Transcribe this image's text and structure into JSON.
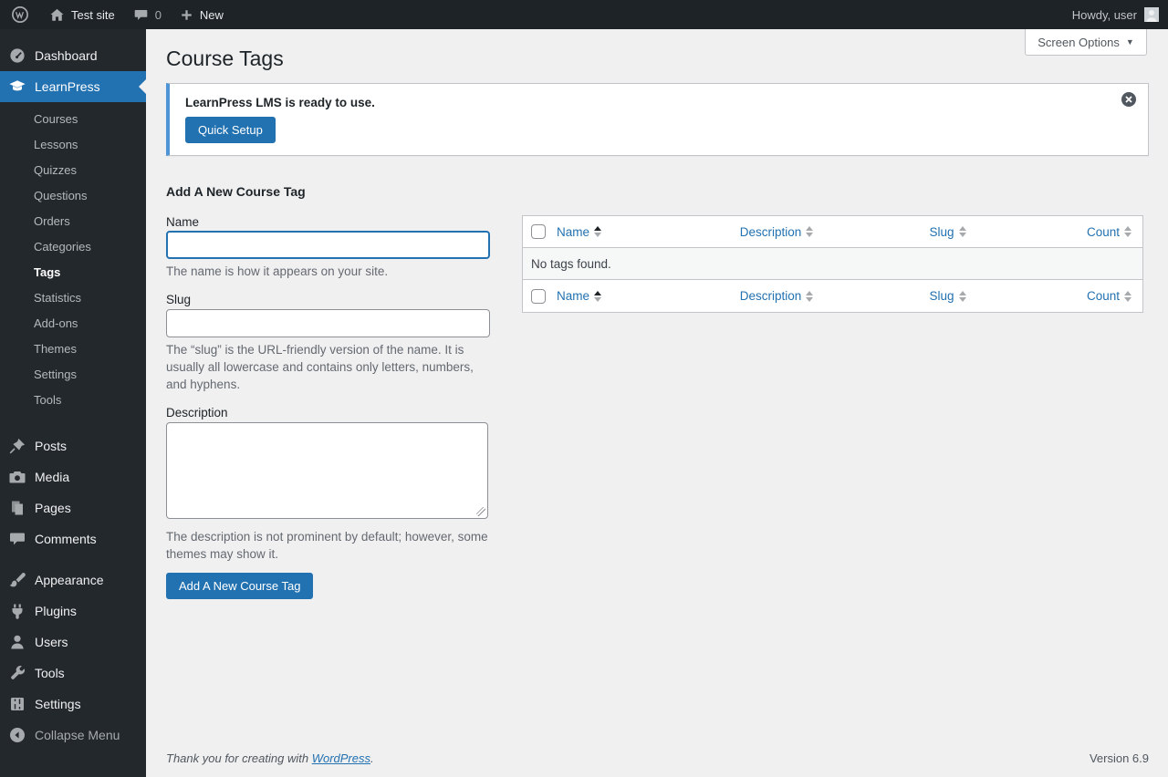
{
  "admin_bar": {
    "site_name": "Test site",
    "comment_count": "0",
    "new_label": "New",
    "howdy": "Howdy, user"
  },
  "sidebar": {
    "dashboard": "Dashboard",
    "learnpress": "LearnPress",
    "learnpress_submenu": [
      "Courses",
      "Lessons",
      "Quizzes",
      "Questions",
      "Orders",
      "Categories",
      "Tags",
      "Statistics",
      "Add-ons",
      "Themes",
      "Settings",
      "Tools"
    ],
    "active_submenu": "Tags",
    "menu": [
      "Posts",
      "Media",
      "Pages",
      "Comments",
      "Appearance",
      "Plugins",
      "Users",
      "Tools",
      "Settings"
    ],
    "collapse_label": "Collapse Menu"
  },
  "page": {
    "title": "Course Tags",
    "screen_options": "Screen Options"
  },
  "notice": {
    "message": "LearnPress LMS is ready to use.",
    "button": "Quick Setup"
  },
  "form": {
    "title": "Add A New Course Tag",
    "name_label": "Name",
    "name_value": "",
    "name_help": "The name is how it appears on your site.",
    "slug_label": "Slug",
    "slug_value": "",
    "slug_help": "The “slug” is the URL-friendly version of the name. It is usually all lowercase and contains only letters, numbers, and hyphens.",
    "description_label": "Description",
    "description_value": "",
    "description_help": "The description is not prominent by default; however, some themes may show it.",
    "submit_label": "Add A New Course Tag"
  },
  "table": {
    "columns": [
      "Name",
      "Description",
      "Slug",
      "Count"
    ],
    "empty_text": "No tags found.",
    "sorted_column": "Name",
    "sort_direction": "asc"
  },
  "footer": {
    "thanks_prefix": "Thank you for creating with ",
    "wordpress_link": "WordPress",
    "thanks_suffix": ".",
    "version": "Version 6.9"
  },
  "icons": {
    "screen_options_arrow": "▼"
  },
  "colors": {
    "accent": "#2271b1",
    "notice_left_border": "#4f94d4",
    "admin_bar_bg": "#1d2327",
    "menu_bg": "#23282d",
    "content_bg": "#f0f0f1"
  }
}
